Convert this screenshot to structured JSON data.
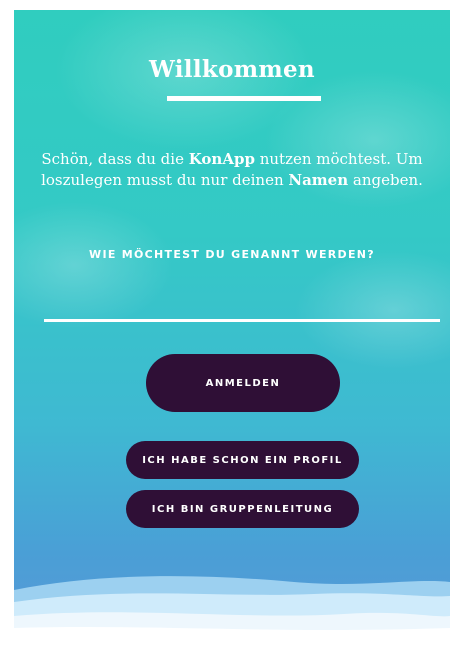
{
  "welcome": {
    "title": "Willkommen",
    "intro_part1": "Schön, dass du die ",
    "intro_app_name": "KonApp",
    "intro_part2": " nutzen möchtest. Um loszulegen musst du nur deinen ",
    "intro_name_word": "Namen",
    "intro_part3": " angeben."
  },
  "form": {
    "question": "WIE MÖCHTEST DU GENANNT WERDEN?",
    "name_value": ""
  },
  "actions": {
    "login_label": "ANMELDEN",
    "have_profile_label": "ICH HABE SCHON EIN PROFIL",
    "group_leader_label": "ICH BIN GRUPPENLEITUNG"
  },
  "colors": {
    "button_bg": "#2f0f36",
    "text": "#ffffff",
    "gradient_top": "#30cdbf",
    "gradient_bottom": "#5b98d8"
  }
}
